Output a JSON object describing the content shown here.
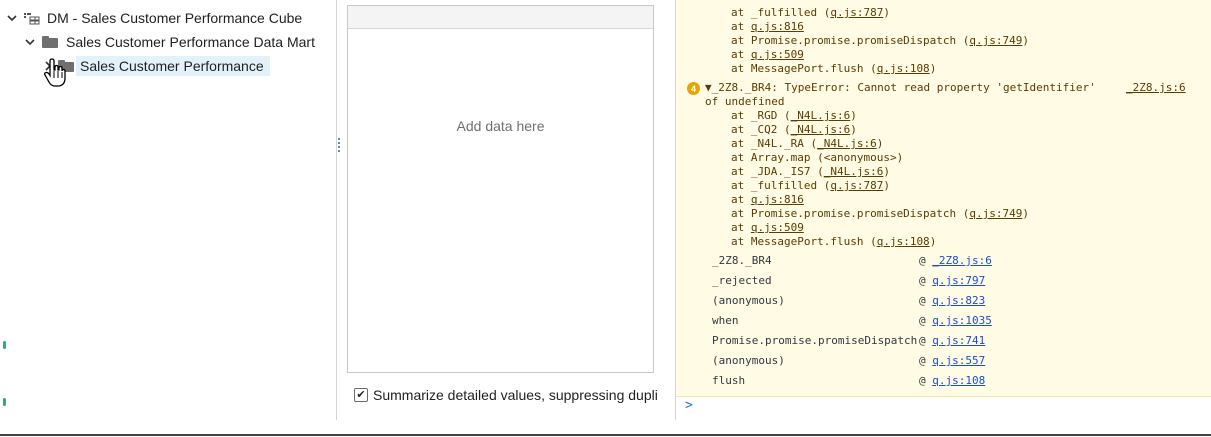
{
  "tree": {
    "items": [
      {
        "label": "DM - Sales Customer Performance Cube",
        "chevron": "down",
        "icon": "cube-icon"
      },
      {
        "label": "Sales Customer Performance Data Mart",
        "chevron": "down",
        "icon": "folder-icon"
      },
      {
        "label": "Sales Customer Performance",
        "chevron": "right",
        "icon": "folder-icon",
        "selected": true
      }
    ]
  },
  "dropzone": {
    "placeholder": "Add data here",
    "summarize_label": "Summarize detailed values, suppressing duplica",
    "summarize_checked": true
  },
  "console": {
    "top_lines": [
      {
        "prefix": "at _fulfilled (",
        "link": "q.js:787",
        "suffix": ")"
      },
      {
        "prefix": "at ",
        "link": "q.js:816",
        "suffix": ""
      },
      {
        "prefix": "at Promise.promise.promiseDispatch (",
        "link": "q.js:749",
        "suffix": ")"
      },
      {
        "prefix": "at ",
        "link": "q.js:509",
        "suffix": ""
      },
      {
        "prefix": "at MessagePort.flush (",
        "link": "q.js:108",
        "suffix": ")"
      }
    ],
    "error": {
      "count": "4",
      "head": "▼_2Z8._BR4:  TypeError: Cannot read property 'getIdentifier'",
      "head_link": "_2Z8.js:6",
      "head_cont": "of undefined"
    },
    "error_lines": [
      {
        "prefix": "at _RGD (",
        "link": "_N4L.js:6",
        "suffix": ")"
      },
      {
        "prefix": "at _CQ2 (",
        "link": "_N4L.js:6",
        "suffix": ")"
      },
      {
        "prefix": "at _N4L._RA (",
        "link": "_N4L.js:6",
        "suffix": ")"
      },
      {
        "prefix": "at Array.map (<anonymous>)",
        "link": "",
        "suffix": ""
      },
      {
        "prefix": "at _JDA._IS7 (",
        "link": "_N4L.js:6",
        "suffix": ")"
      },
      {
        "prefix": "at _fulfilled (",
        "link": "q.js:787",
        "suffix": ")"
      },
      {
        "prefix": "at ",
        "link": "q.js:816",
        "suffix": ""
      },
      {
        "prefix": "at Promise.promise.promiseDispatch (",
        "link": "q.js:749",
        "suffix": ")"
      },
      {
        "prefix": "at ",
        "link": "q.js:509",
        "suffix": ""
      },
      {
        "prefix": "at MessagePort.flush (",
        "link": "q.js:108",
        "suffix": ")"
      }
    ],
    "stack": [
      {
        "fn": "_2Z8._BR4",
        "loc": "_2Z8.js:6"
      },
      {
        "fn": "_rejected",
        "loc": "q.js:797"
      },
      {
        "fn": "(anonymous)",
        "loc": "q.js:823"
      },
      {
        "fn": "when",
        "loc": "q.js:1035"
      },
      {
        "fn": "Promise.promise.promiseDispatch",
        "loc": "q.js:741"
      },
      {
        "fn": "(anonymous)",
        "loc": "q.js:557"
      },
      {
        "fn": "flush",
        "loc": "q.js:108"
      }
    ],
    "at_sign": "@",
    "prompt": ">",
    "colors": {
      "warn_bg": "#fffbe5",
      "link_blue": "#1a4ed6",
      "badge": "#e6a500"
    }
  }
}
